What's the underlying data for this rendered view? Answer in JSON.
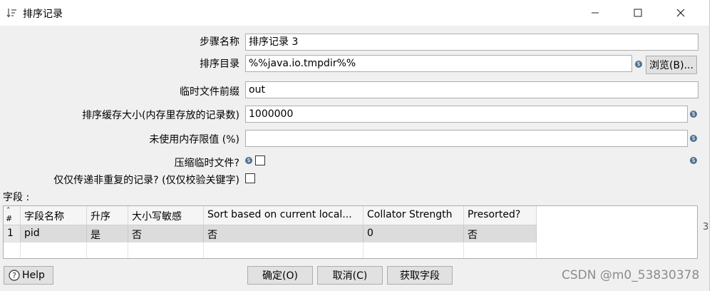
{
  "window": {
    "title": "排序记录",
    "minimize_icon": "minimize-icon",
    "maximize_icon": "maximize-icon",
    "close_icon": "close-icon"
  },
  "form": {
    "step_name_label": "步骤名称",
    "step_name_value": "排序记录 3",
    "sort_dir_label": "排序目录",
    "sort_dir_value": "%%java.io.tmpdir%%",
    "browse_label": "浏览(B)...",
    "temp_prefix_label": "临时文件前缀",
    "temp_prefix_value": "out",
    "cache_size_label": "排序缓存大小(内存里存放的记录数)",
    "cache_size_value": "1000000",
    "free_memory_label": "未使用内存限值 (%)",
    "free_memory_value": "",
    "compress_label": "压缩临时文件?",
    "compress_checked": false,
    "unique_label": "仅仅传递非重复的记录? (仅仅校验关键字)",
    "unique_checked": false,
    "fields_label": "字段 :"
  },
  "table": {
    "columns": [
      "#",
      "字段名称",
      "升序",
      "大小写敏感",
      "Sort based on current local...",
      "Collator Strength",
      "Presorted?"
    ],
    "rows": [
      [
        "1",
        "pid",
        "是",
        "否",
        "否",
        "0",
        "否"
      ]
    ]
  },
  "buttons": {
    "help": "Help",
    "ok": "确定(O)",
    "cancel": "取消(C)",
    "get_fields": "获取字段"
  },
  "background": {
    "side_text": "3",
    "watermark": "CSDN @m0_53830378"
  }
}
